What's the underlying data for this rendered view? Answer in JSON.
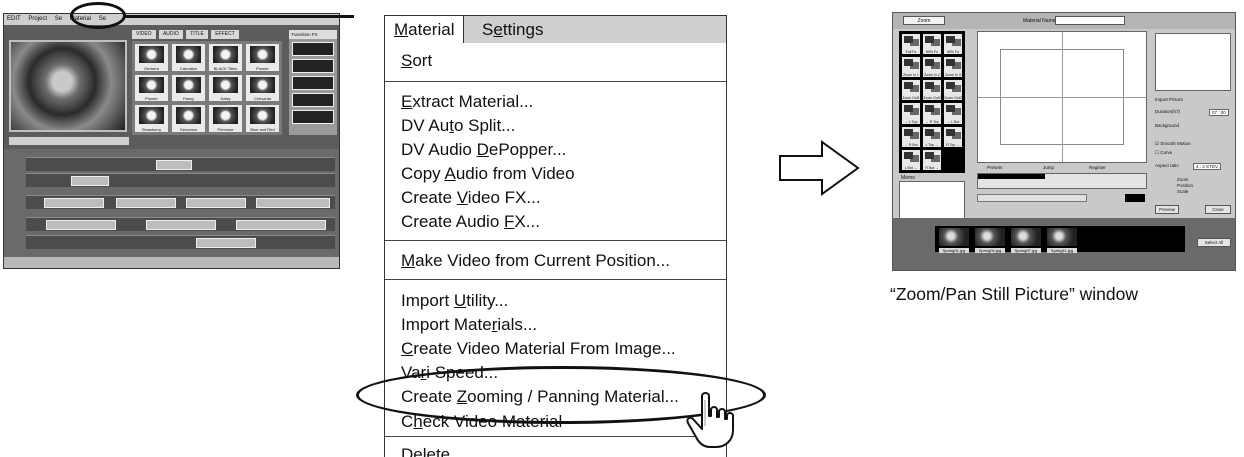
{
  "editor_thumbnail": {
    "menubar": [
      "EDIT",
      "Project",
      "Se",
      "Material",
      "Se"
    ],
    "bin_tabs": [
      "VIDEO",
      "AUDIO",
      "TITLE",
      "EFFECT"
    ],
    "fx_dropdown": "Transition FX",
    "bin_items": [
      "Gerbera",
      "Carnation",
      "BLACK Titles",
      "Plumer",
      "Plumer",
      "Pansy",
      "Daisy",
      "Chrisanta",
      "Strawberry",
      "Geranium",
      "Primrose",
      "Blue and Red"
    ]
  },
  "menu": {
    "tabs": {
      "material": "Material",
      "settings": "Settings"
    },
    "items": [
      {
        "id": "sort",
        "pre": "",
        "key": "S",
        "post": "ort",
        "submenu": true
      },
      {
        "id": "extract",
        "pre": "",
        "key": "E",
        "post": "xtract Material...",
        "submenu": false
      },
      {
        "id": "dv-auto-split",
        "pre": "DV Au",
        "key": "t",
        "post": "o Split...",
        "submenu": false
      },
      {
        "id": "dv-audio-depopper",
        "pre": "DV Audio ",
        "key": "D",
        "post": "ePopper...",
        "submenu": false
      },
      {
        "id": "copy-audio",
        "pre": "Copy ",
        "key": "A",
        "post": "udio from Video",
        "submenu": false
      },
      {
        "id": "create-video-fx",
        "pre": "Create ",
        "key": "V",
        "post": "ideo FX...",
        "submenu": true
      },
      {
        "id": "create-audio-fx",
        "pre": "Create Audio ",
        "key": "F",
        "post": "X...",
        "submenu": true
      },
      {
        "id": "make-video",
        "pre": "",
        "key": "M",
        "post": "ake Video from Current Position...",
        "submenu": false
      },
      {
        "id": "import-utility",
        "pre": "Import ",
        "key": "U",
        "post": "tility...",
        "submenu": false
      },
      {
        "id": "import-materials",
        "pre": "Import Mate",
        "key": "r",
        "post": "ials...",
        "submenu": false
      },
      {
        "id": "create-video-from-image",
        "pre": "",
        "key": "C",
        "post": "reate Video Material From Image...",
        "submenu": false
      },
      {
        "id": "vari-speed",
        "pre": "Va",
        "key": "r",
        "post": "i Speed...",
        "submenu": false
      },
      {
        "id": "create-zooming-panning",
        "pre": "Create ",
        "key": "Z",
        "post": "ooming / Panning Material...",
        "submenu": false
      },
      {
        "id": "check-video",
        "pre": "C",
        "key": "h",
        "post": "eck Video Material",
        "submenu": false
      },
      {
        "id": "delete",
        "pre": "",
        "key": "",
        "post": "Delete",
        "submenu": false
      }
    ]
  },
  "zoom_window": {
    "mode_dropdown": "Zoom",
    "material_name_label": "Material Name",
    "patterns": [
      "Full Fo",
      "80% Fo",
      "50% Fo",
      "Zoom In 1",
      "Zoom In 2",
      "Zoom In 3",
      "Zoom Out1",
      "Zoom Out2",
      "Zoom Out3",
      "→ L Top",
      "→ R Top",
      "→ L Bot",
      "→ R Bot",
      "L Top →",
      "R Top →",
      "L Bot →",
      "R Bot →"
    ],
    "side_labels": {
      "import_picture": "Import Picture",
      "duration": "Duration(h:f)",
      "duration_value": "07 : 00",
      "background": "Background",
      "smooth_motion": "Smooth Motion",
      "curve": "Curve",
      "aspect_ratio": "Aspect ratio",
      "aspect_value": "4 : 3 STDV",
      "zoom": "Zoom",
      "position": "Position",
      "scale": "Scale"
    },
    "memo_label": "Memo",
    "ruler_labels": {
      "presets": "Presets",
      "jump": "Jump",
      "register": "Register"
    },
    "buttons": {
      "preview": "Preview",
      "close": "Close",
      "select_all": "Select All"
    },
    "tray": [
      "Spring01.jpg",
      "Spring04.jpg",
      "Spring07.jpg",
      "Spring11.jpg"
    ]
  },
  "caption": "“Zoom/Pan Still Picture” window"
}
